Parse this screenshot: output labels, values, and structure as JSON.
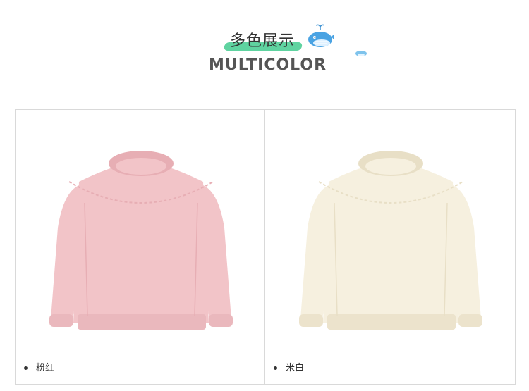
{
  "header": {
    "title_cn": "多色展示",
    "title_en": "MULTICOLOR"
  },
  "colors": {
    "accent": "#5fd3a0",
    "pink": "#f2c4c8",
    "cream": "#f6f0df"
  },
  "products": [
    {
      "label": "粉红",
      "color": "#f2c4c8",
      "shade": "#e7aeb4",
      "rib": "#eab8bd"
    },
    {
      "label": "米白",
      "color": "#f6f0df",
      "shade": "#e8dfc6",
      "rib": "#ece3cc"
    }
  ]
}
